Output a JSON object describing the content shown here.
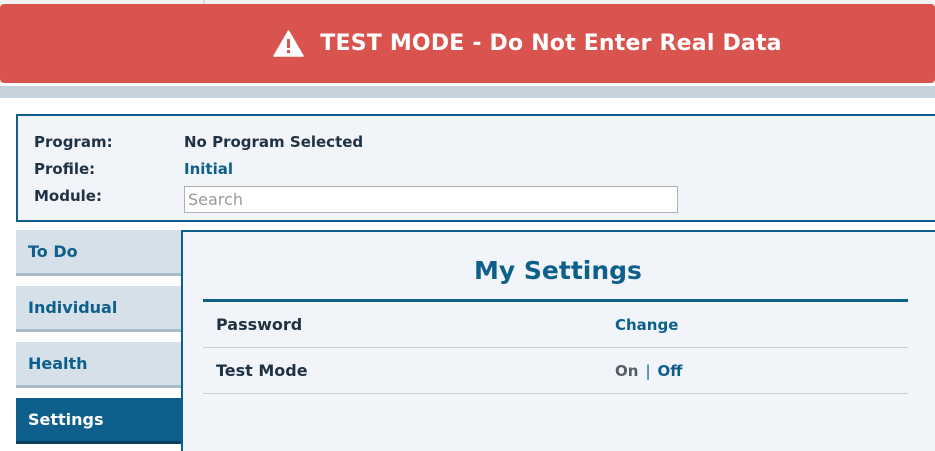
{
  "banner": {
    "text": "TEST MODE - Do Not Enter Real Data",
    "icon": "warning-triangle-icon",
    "color": "#d9534f"
  },
  "info": {
    "program_label": "Program:",
    "program_value": "No Program Selected",
    "profile_label": "Profile:",
    "profile_value": "Initial",
    "module_label": "Module:",
    "module_placeholder": "Search"
  },
  "sidebar": {
    "items": [
      {
        "label": "To Do",
        "active": false
      },
      {
        "label": "Individual",
        "active": false
      },
      {
        "label": "Health",
        "active": false
      },
      {
        "label": "Settings",
        "active": true
      }
    ]
  },
  "main": {
    "title": "My Settings",
    "rows": [
      {
        "label": "Password",
        "action": "Change"
      },
      {
        "label": "Test Mode",
        "current": "On",
        "separator": "|",
        "alternate": "Off"
      }
    ]
  },
  "colors": {
    "accent": "#0e5f8c",
    "panel_bg": "#f1f5f9",
    "sidebar_bg": "#d5e0e8"
  }
}
